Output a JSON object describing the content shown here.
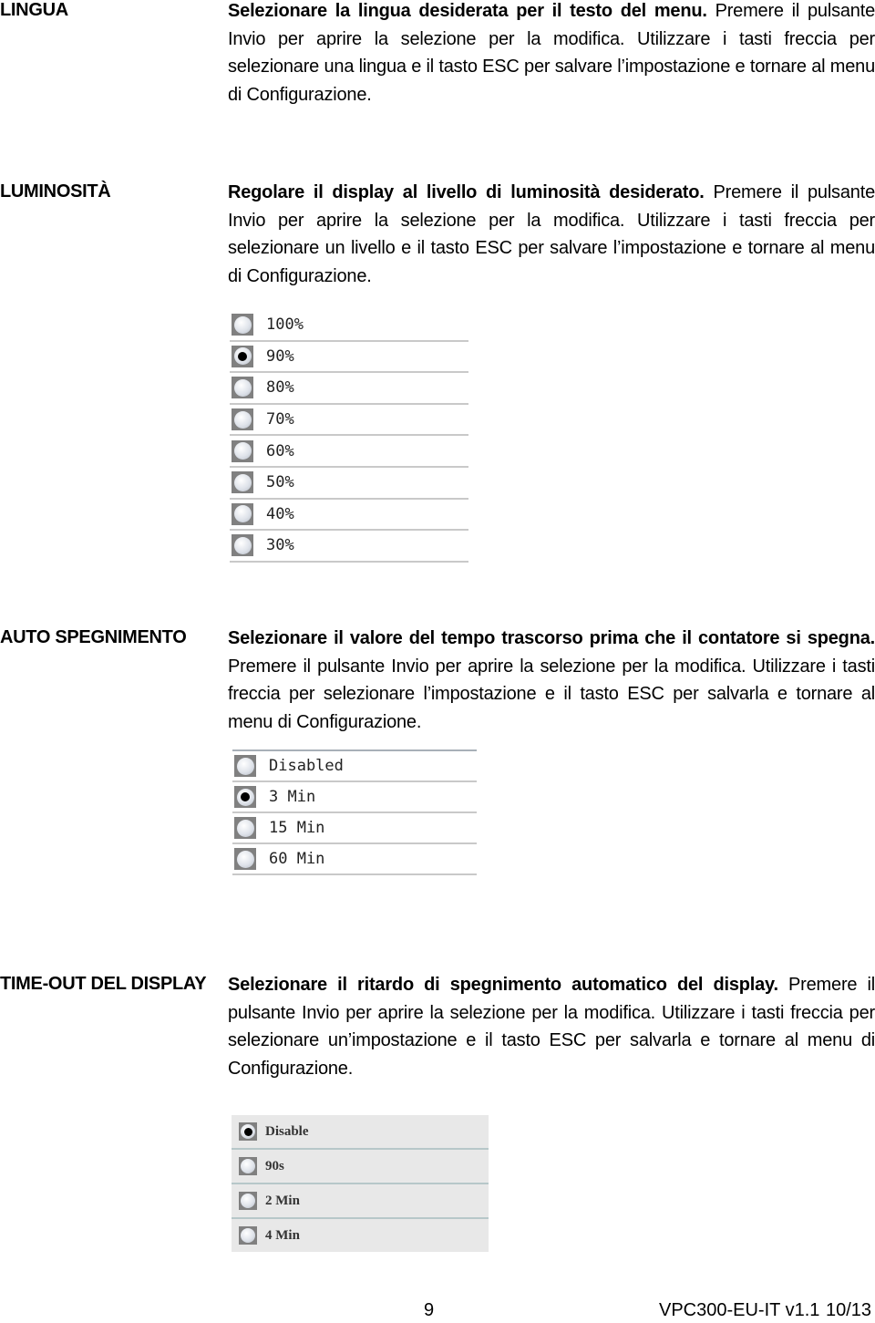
{
  "sections": [
    {
      "term": "LINGUA",
      "bold_text": "Selezionare la lingua desiderata per il testo del menu.",
      "body_text": " Premere il pulsante Invio per aprire la selezione per la modifica. Utilizzare i tasti freccia per selezionare una lingua e il tasto ESC per salvare l’impostazione e tornare al menu di Configurazione."
    },
    {
      "term": "LUMINOSITÀ",
      "bold_text": "Regolare il display al livello di luminosità desiderato.",
      "body_text": " Premere il pulsante Invio per aprire la selezione per la modifica. Utilizzare i tasti freccia per selezionare un livello e il tasto ESC per salvare l’impostazione e tornare al menu di Configurazione.",
      "options": [
        {
          "label": "100%",
          "selected": false
        },
        {
          "label": "90%",
          "selected": true
        },
        {
          "label": "80%",
          "selected": false
        },
        {
          "label": "70%",
          "selected": false
        },
        {
          "label": "60%",
          "selected": false
        },
        {
          "label": "50%",
          "selected": false
        },
        {
          "label": "40%",
          "selected": false
        },
        {
          "label": "30%",
          "selected": false
        }
      ]
    },
    {
      "term": "AUTO SPEGNIMENTO",
      "bold_text": "Selezionare il valore del tempo trascorso prima che il contatore si spegna.",
      "body_text": " Premere il pulsante Invio per aprire la selezione per la modifica. Utilizzare i tasti freccia per selezionare l’impostazione e il tasto ESC per salvarla e tornare al menu di Configurazione.",
      "options": [
        {
          "label": "Disabled",
          "selected": false
        },
        {
          "label": "3 Min",
          "selected": true
        },
        {
          "label": "15 Min",
          "selected": false
        },
        {
          "label": "60 Min",
          "selected": false
        }
      ]
    },
    {
      "term": "TIME-OUT DEL DISPLAY",
      "bold_text": "Selezionare il ritardo di spegnimento automatico del display.",
      "body_text": " Premere il pulsante Invio per aprire la selezione per la modifica. Utilizzare i tasti freccia per selezionare un’impostazione e il tasto ESC per salvarla e tornare al menu di Configurazione.",
      "options": [
        {
          "label": "Disable",
          "selected": true
        },
        {
          "label": "90s",
          "selected": false
        },
        {
          "label": "2 Min",
          "selected": false
        },
        {
          "label": "4 Min",
          "selected": false
        }
      ]
    }
  ],
  "footer": {
    "page_number": "9",
    "doc_id": "VPC300-EU-IT v1.1",
    "page_of": "10/13"
  }
}
